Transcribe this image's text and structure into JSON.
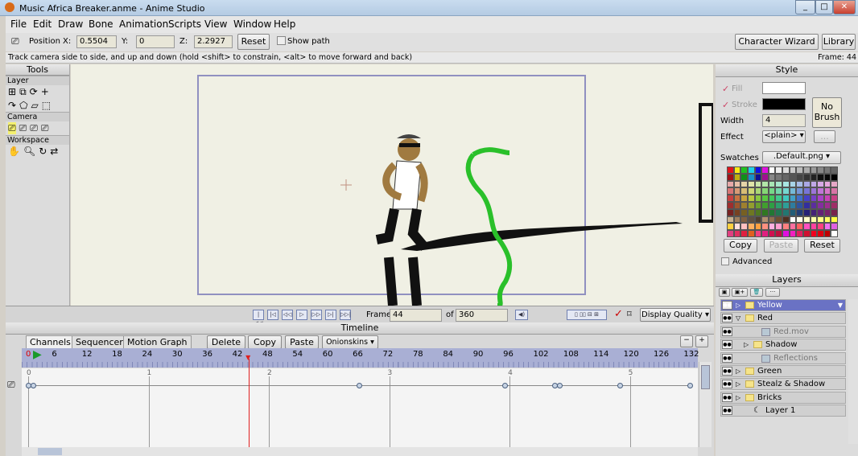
{
  "window": {
    "title": "Music Africa Breaker.anme - Anime Studio",
    "controls": [
      "_",
      "□",
      "✕"
    ]
  },
  "menu": [
    "File",
    "Edit",
    "Draw",
    "Bone",
    "Animation",
    "Scripts",
    "View",
    "Window",
    "Help"
  ],
  "toolbar": {
    "position_label": "Position",
    "x_label": "X:",
    "x": "0.5504",
    "y_label": "Y:",
    "y": "0",
    "z_label": "Z:",
    "z": "2.2927",
    "reset": "Reset",
    "show_path": "Show path",
    "show_path_checked": false,
    "character_wizard": "Character Wizard",
    "library": "Library"
  },
  "status": {
    "hint": "Track camera side to side, and up and down (hold <shift> to constrain, <alt> to move forward and back)",
    "frame": "Frame: 44"
  },
  "tools": {
    "title": "Tools",
    "sections": [
      {
        "label": "Layer"
      },
      {
        "label": "Camera"
      },
      {
        "label": "Workspace"
      }
    ]
  },
  "playback": {
    "frame_label": "Frame",
    "frame": "44",
    "of_label": "of",
    "total": "360",
    "display_quality": "Display Quality"
  },
  "timeline": {
    "title": "Timeline",
    "tabs": [
      "Channels",
      "Sequencer",
      "Motion Graph"
    ],
    "active_tab": "Channels",
    "delete": "Delete",
    "copy": "Copy",
    "paste": "Paste",
    "onionskins": "Onionskins",
    "ruler_labels": [
      "0",
      "6",
      "12",
      "18",
      "24",
      "30",
      "36",
      "42",
      "48",
      "54",
      "60",
      "66",
      "72",
      "78",
      "84",
      "90",
      "96",
      "102",
      "108",
      "114",
      "120",
      "126",
      "132"
    ],
    "second_labels": [
      "0",
      "1",
      "2",
      "3",
      "4",
      "5"
    ],
    "current_frame": 44,
    "keyframes": [
      0,
      1,
      66,
      95,
      105,
      106,
      118,
      132
    ]
  },
  "style": {
    "title": "Style",
    "fill": "Fill",
    "stroke": "Stroke",
    "width_label": "Width",
    "width": "4",
    "no_brush": "No Brush",
    "effect_label": "Effect",
    "effect": "<plain>",
    "effect_more": "...",
    "swatches_label": "Swatches",
    "swatches": ".Default.png",
    "copy": "Copy",
    "paste": "Paste",
    "reset": "Reset",
    "advanced": "Advanced",
    "fill_color": "#ffffff",
    "stroke_color": "#000000"
  },
  "layers": {
    "title": "Layers",
    "items": [
      {
        "name": "Yellow",
        "type": "folder",
        "indent": 0,
        "expand": "▷",
        "selected": true
      },
      {
        "name": "Red",
        "type": "folder",
        "indent": 0,
        "expand": "▽"
      },
      {
        "name": "Red.mov",
        "type": "image",
        "indent": 2,
        "expand": ""
      },
      {
        "name": "Shadow",
        "type": "folder",
        "indent": 1,
        "expand": "▷"
      },
      {
        "name": "Reflections",
        "type": "image",
        "indent": 2,
        "expand": ""
      },
      {
        "name": "Green",
        "type": "folder",
        "indent": 0,
        "expand": "▷"
      },
      {
        "name": "Stealz & Shadow",
        "type": "folder",
        "indent": 0,
        "expand": "▷"
      },
      {
        "name": "Bricks",
        "type": "folder",
        "indent": 0,
        "expand": "▷"
      },
      {
        "name": "Layer 1",
        "type": "vector",
        "indent": 1,
        "expand": ""
      }
    ]
  }
}
